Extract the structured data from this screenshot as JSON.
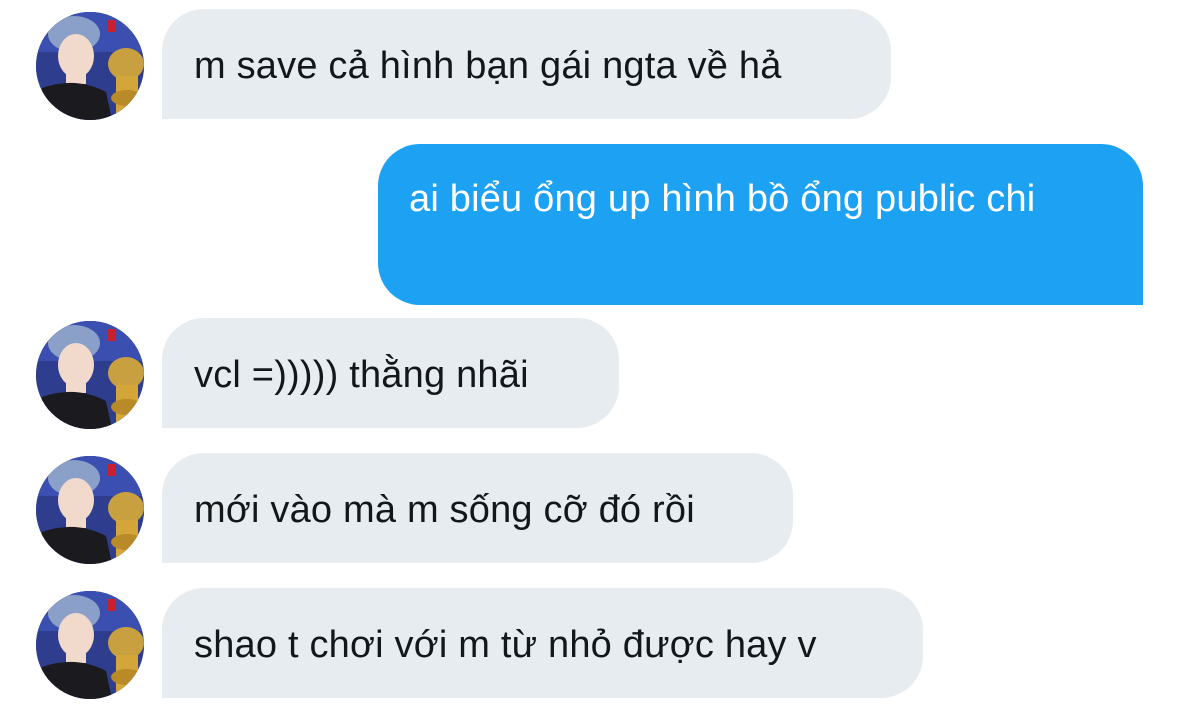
{
  "conversation": {
    "messages": [
      {
        "direction": "incoming",
        "text": "m save cả hình bạn gái ngta về hả"
      },
      {
        "direction": "outgoing",
        "text": "ai biểu ổng up hình bồ ổng public chi"
      },
      {
        "direction": "incoming",
        "text": "vcl =))))) thằng nhãi"
      },
      {
        "direction": "incoming",
        "text": "mới vào mà m sống cỡ đó rồi"
      },
      {
        "direction": "incoming",
        "text": "shao t chơi với m từ nhỏ được hay v"
      }
    ]
  },
  "colors": {
    "incoming_bubble": "#e6ecf0",
    "incoming_text": "#14171a",
    "outgoing_bubble": "#1da1f2",
    "outgoing_text": "#ffffff"
  },
  "icons": {
    "avatar": "user-avatar-photo"
  }
}
